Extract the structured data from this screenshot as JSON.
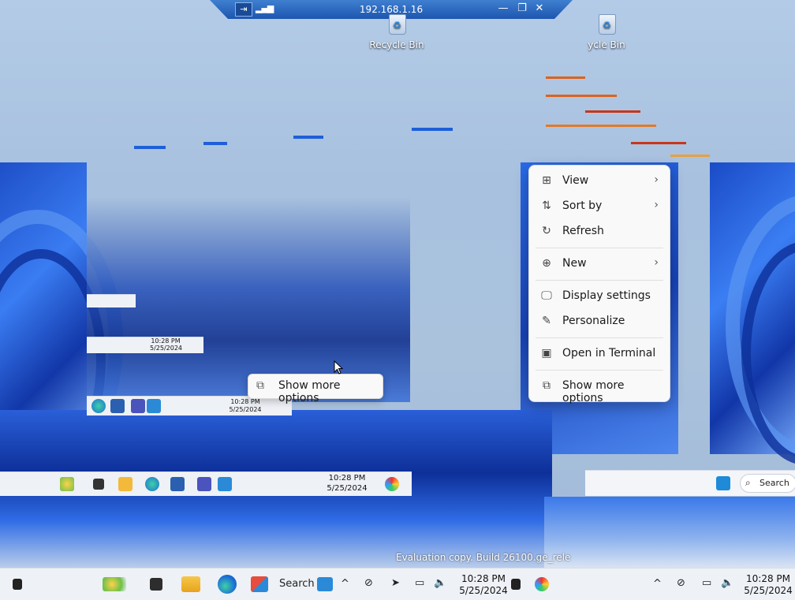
{
  "remote_bar": {
    "host": "192.168.1.16",
    "pin_label": "⇥",
    "signal_label": "▂▄▆",
    "minimize_label": "—",
    "restore_label": "❐",
    "close_label": "✕"
  },
  "desktop_icons": {
    "recycle_bin_label": "Recycle Bin",
    "recycle_bin_label_clipped": "ycle Bin"
  },
  "context_menu": {
    "items": [
      {
        "label": "View",
        "icon": "grid-icon",
        "glyph": "⊞",
        "submenu": true
      },
      {
        "label": "Sort by",
        "icon": "sort-icon",
        "glyph": "⇅",
        "submenu": true
      },
      {
        "label": "Refresh",
        "icon": "refresh-icon",
        "glyph": "↻",
        "submenu": false
      },
      {
        "label": "New",
        "icon": "plus-circle-icon",
        "glyph": "⊕",
        "submenu": true
      },
      {
        "label": "Display settings",
        "icon": "display-icon",
        "glyph": "🖵",
        "submenu": false
      },
      {
        "label": "Personalize",
        "icon": "pen-icon",
        "glyph": "✎",
        "submenu": false
      },
      {
        "label": "Open in Terminal",
        "icon": "terminal-icon",
        "glyph": "▣",
        "submenu": false
      },
      {
        "label": "Show more options",
        "icon": "expand-icon",
        "glyph": "⧉",
        "submenu": false
      }
    ],
    "submenu_arrow": "›"
  },
  "ghost_menu": {
    "label": "Show more options",
    "glyph": "⧉"
  },
  "taskbar_main": {
    "search_label": "Search",
    "time": "10:28 PM",
    "date": "5/25/2024",
    "chevron": "^",
    "time_right": "10:28 PM",
    "date_right": "5/25/2024"
  },
  "taskbar_mid": {
    "time": "10:28 PM",
    "date": "5/25/2024",
    "search_label": "Search"
  },
  "taskbar_small": {
    "time": "10:28 PM",
    "date": "5/25/2024"
  },
  "watermark": {
    "text": "Evaluation copy. Build 26100.ge_rele"
  },
  "colors": {
    "accent": "#1d5fd8",
    "swirl_dark": "#0a2a8a",
    "swirl_mid": "#2060e0",
    "taskbar": "#eef1f6"
  }
}
